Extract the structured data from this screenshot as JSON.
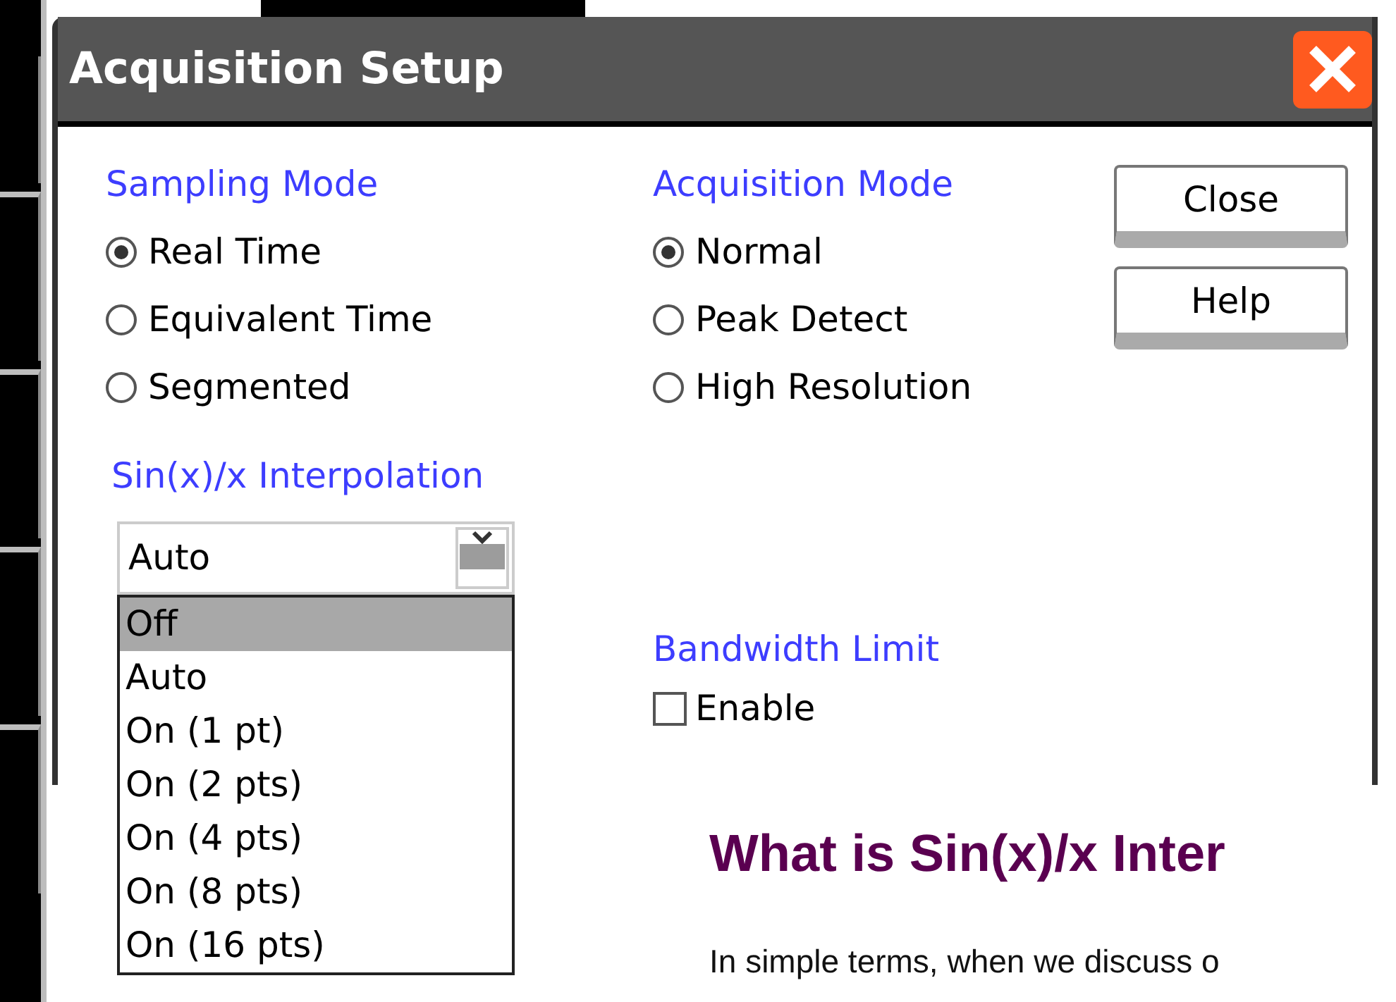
{
  "window": {
    "title": "Acquisition Setup"
  },
  "sampling_mode": {
    "label": "Sampling Mode",
    "options": [
      {
        "label": "Real Time",
        "selected": true
      },
      {
        "label": "Equivalent Time",
        "selected": false
      },
      {
        "label": "Segmented",
        "selected": false
      }
    ]
  },
  "acquisition_mode": {
    "label": "Acquisition Mode",
    "options": [
      {
        "label": "Normal",
        "selected": true
      },
      {
        "label": "Peak Detect",
        "selected": false
      },
      {
        "label": "High Resolution",
        "selected": false
      }
    ]
  },
  "buttons": [
    "Close",
    "Help"
  ],
  "interpolation": {
    "label": "Sin(x)/x Interpolation",
    "value": "Auto",
    "options": [
      {
        "label": "Off",
        "highlighted": true
      },
      {
        "label": "Auto",
        "highlighted": false
      },
      {
        "label": "On (1 pt)",
        "highlighted": false
      },
      {
        "label": "On (2 pts)",
        "highlighted": false
      },
      {
        "label": "On (4 pts)",
        "highlighted": false
      },
      {
        "label": "On (8 pts)",
        "highlighted": false
      },
      {
        "label": "On (16 pts)",
        "highlighted": false
      }
    ]
  },
  "bandwidth_limit": {
    "label": "Bandwidth Limit",
    "checkbox": {
      "label": "Enable",
      "checked": false
    }
  },
  "article": {
    "heading": "What is Sin(x)/x Inter",
    "text": "In simple terms, when we discuss o"
  }
}
